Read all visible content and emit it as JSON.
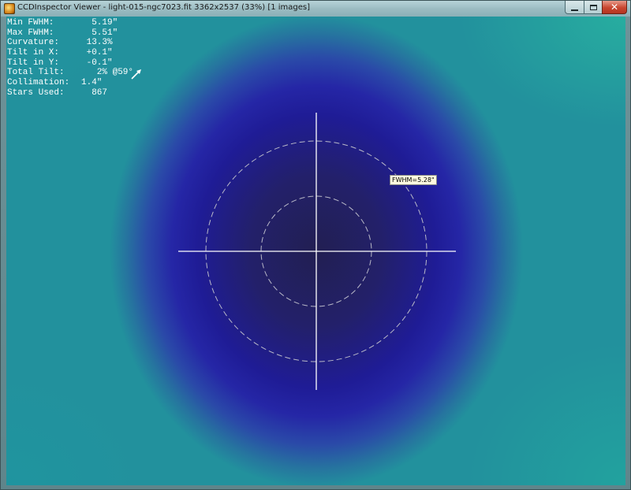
{
  "window": {
    "title": "CCDInspector Viewer - light-015-ngc7023.fit 3362x2537 (33%)  [1 images]",
    "close_label": "✕"
  },
  "stats": [
    {
      "label": "Min FWHM:",
      "value": "  5.19\""
    },
    {
      "label": "Max FWHM:",
      "value": "  5.51\""
    },
    {
      "label": "Curvature:",
      "value": " 13.3%"
    },
    {
      "label": "Tilt in X:",
      "value": " +0.1\""
    },
    {
      "label": "Tilt in Y:",
      "value": " -0.1\""
    },
    {
      "label": "Total Tilt:",
      "value": "   2% @59°"
    },
    {
      "label": "Collimation:",
      "value": "1.4\""
    },
    {
      "label": "Stars Used:",
      "value": "  867"
    }
  ],
  "overlay": {
    "fwhm_label": "FWHM=5.28\""
  },
  "icons": {
    "app": "ccdinspector-app-icon",
    "tilt": "tilt-direction-arrow-icon"
  },
  "colors": {
    "center": "#221f52",
    "ring": "#1f1c96",
    "edge": "#1d9b9c",
    "crosshair": "#ffffff"
  }
}
